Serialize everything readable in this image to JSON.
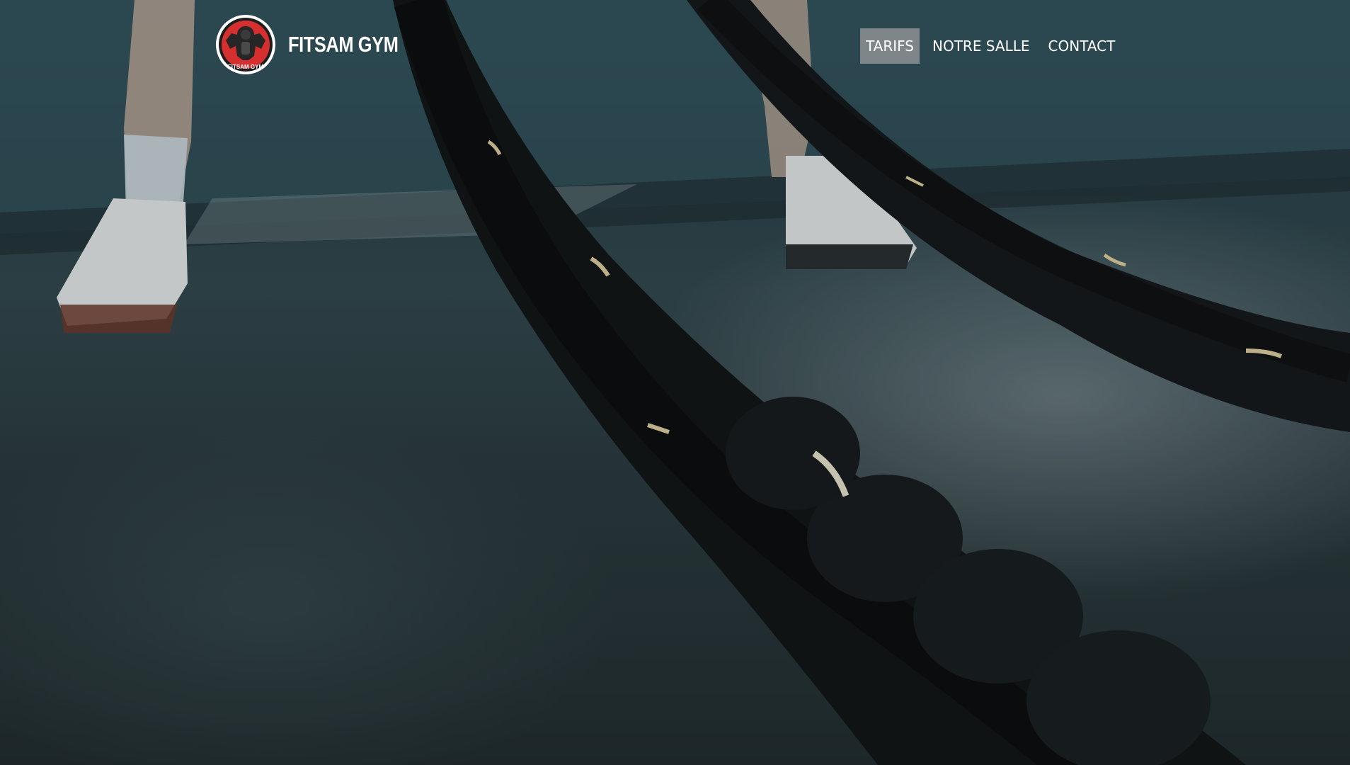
{
  "brand": {
    "name": "FITSAM GYM",
    "logo_text": "FITSAM GYM",
    "logo_color": "#d62f2f"
  },
  "nav": {
    "items": [
      {
        "label": "TARIFS",
        "active": true
      },
      {
        "label": "NOTRE SALLE",
        "active": false
      },
      {
        "label": "CONTACT",
        "active": false
      }
    ]
  },
  "colors": {
    "nav_text": "#ffffff",
    "active_bg": "#a0a0a0"
  }
}
